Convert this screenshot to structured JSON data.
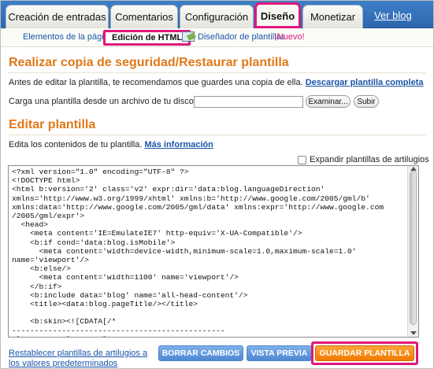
{
  "tabs": {
    "items": [
      {
        "label": "Creación de entradas"
      },
      {
        "label": "Comentarios"
      },
      {
        "label": "Configuración"
      },
      {
        "label": "Diseño",
        "active": true
      },
      {
        "label": "Monetizar"
      }
    ],
    "view_blog": "Ver blog"
  },
  "subnav": {
    "page_elements": "Elementos de la página",
    "edit_html": "Edición de HTML",
    "template_designer": "Diseñador de plantillas",
    "new_badge": "¡Nuevo!"
  },
  "backup": {
    "title": "Realizar copia de seguridad/Restaurar plantilla",
    "intro": "Antes de editar la plantilla, te recomendamos que guardes una copia de ella.",
    "download_link": "Descargar plantilla completa",
    "upload_label": "Carga una plantilla desde un archivo de tu disco duro:",
    "browse_button": "Examinar...",
    "upload_button": "Subir"
  },
  "editor": {
    "title": "Editar plantilla",
    "intro": "Edita los contenidos de tu plantilla.",
    "more_info": "Más información",
    "expand_widgets_label": "Expandir plantillas de artilugios",
    "code": "<?xml version=\"1.0\" encoding=\"UTF-8\" ?>\n<!DOCTYPE html>\n<html b:version='2' class='v2' expr:dir='data:blog.languageDirection'\nxmlns='http://www.w3.org/1999/xhtml' xmlns:b='http://www.google.com/2005/gml/b'\nxmlns:data='http://www.google.com/2005/gml/data' xmlns:expr='http://www.google.com\n/2005/gml/expr'>\n  <head>\n    <meta content='IE=EmulateIE7' http-equiv='X-UA-Compatible'/>\n    <b:if cond='data:blog.isMobile'>\n      <meta content='width=device-width,minimum-scale=1.0,maximum-scale=1.0'\nname='viewport'/>\n    <b:else/>\n      <meta content='width=1100' name='viewport'/>\n    </b:if>\n    <b:include data='blog' name='all-head-content'/>\n    <title><data:blog.pageTitle/></title>\n\n    <b:skin><![CDATA[/*\n-----------------------------------------------\nBlogger Template Style\nName:     Awesome Inc."
  },
  "actions": {
    "restore_defaults": "Restablecer plantillas de artilugios a los valores predeterminados",
    "clear_changes": "BORRAR CAMBIOS",
    "preview": "VISTA PREVIA",
    "save": "GUARDAR PLANTILLA"
  },
  "colors": {
    "header_blue": "#2e66ad",
    "section_orange": "#e07818",
    "highlight_pink": "#e0177a",
    "save_orange": "#f07a00",
    "button_blue": "#4d88d3",
    "link_blue": "#1a55a8"
  }
}
